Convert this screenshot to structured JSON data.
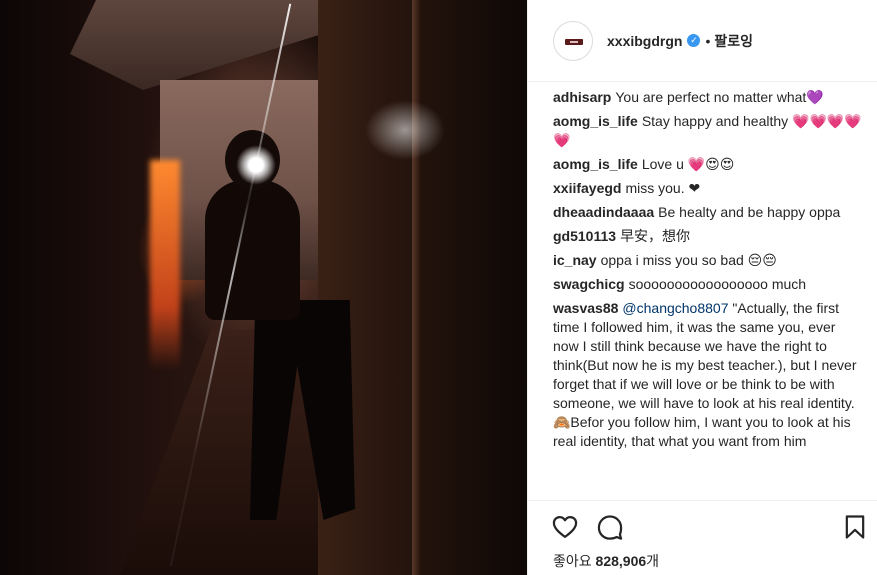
{
  "header": {
    "username": "xxxibgdrgn",
    "verified_icon": "verified-badge-icon",
    "separator": "•",
    "follow_label": "팔로잉"
  },
  "comments": [
    {
      "user": "adhisarp",
      "text": "You are perfect no matter what💜"
    },
    {
      "user": "aomg_is_life",
      "text": "Stay happy and healthy 💗💗💗💗💗"
    },
    {
      "user": "aomg_is_life",
      "text": "Love u 💗😍😍"
    },
    {
      "user": "xxiifayegd",
      "text": "miss you. ❤"
    },
    {
      "user": "dheaadindaaaa",
      "text": "Be healty and be happy oppa"
    },
    {
      "user": "gd510113",
      "text": "早安，想你"
    },
    {
      "user": "ic_nay",
      "text": "oppa i miss you so bad 😔😔"
    },
    {
      "user": "swagchicg",
      "text": "sooooooooooooooooo much"
    },
    {
      "user": "wasvas88",
      "mention": "@changcho8807",
      "text": " \"Actually, the first time I followed him, it was the same you, ever now I still think because we have the right to think(But now he is my best teacher.), but I never forget that if we will love or be think to be with someone, we will have to look at his real identity. 🙈Befor you follow him, I want you to look at his real identity, that what you want from him"
    }
  ],
  "actions": {
    "like_icon": "heart-icon",
    "comment_icon": "comment-bubble-icon",
    "save_icon": "bookmark-icon"
  },
  "likes": {
    "prefix": "좋아요 ",
    "count": "828,906",
    "suffix": "개"
  }
}
